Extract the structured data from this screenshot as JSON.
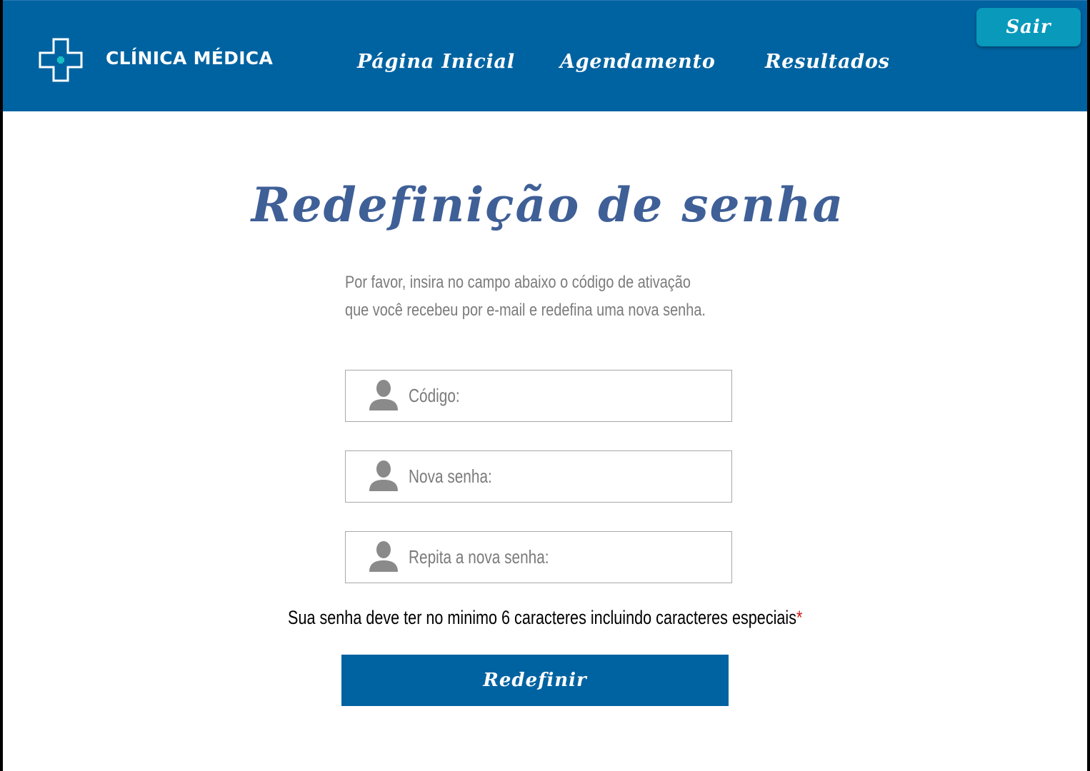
{
  "header": {
    "brand": "CLÍNICA MÉDICA",
    "logo_icon": "medical-cross-icon",
    "nav": [
      {
        "label": "Página Inicial"
      },
      {
        "label": "Agendamento"
      },
      {
        "label": "Resultados"
      }
    ],
    "logout_label": "Sair"
  },
  "page": {
    "title": "Redefinição de senha",
    "instructions": [
      "Por favor,  insira no campo abaixo o código de ativação",
      "que você recebeu por e-mail e redefina uma nova senha."
    ]
  },
  "form": {
    "fields": [
      {
        "placeholder": "Código:",
        "value": "",
        "icon": "user-icon"
      },
      {
        "placeholder": "Nova senha:",
        "value": "",
        "icon": "user-icon"
      },
      {
        "placeholder": "Repita a nova senha:",
        "value": "",
        "icon": "user-icon"
      }
    ],
    "hint": "Sua senha deve ter no minimo 6 caracteres incluindo caracteres especiais",
    "hint_required_mark": "*",
    "submit_label": "Redefinir"
  },
  "colors": {
    "header_bg": "#0063a1",
    "logout_bg": "#0899bb",
    "title": "#3f5f97",
    "muted_text": "#7b7b7b",
    "required": "#d11a1a"
  }
}
